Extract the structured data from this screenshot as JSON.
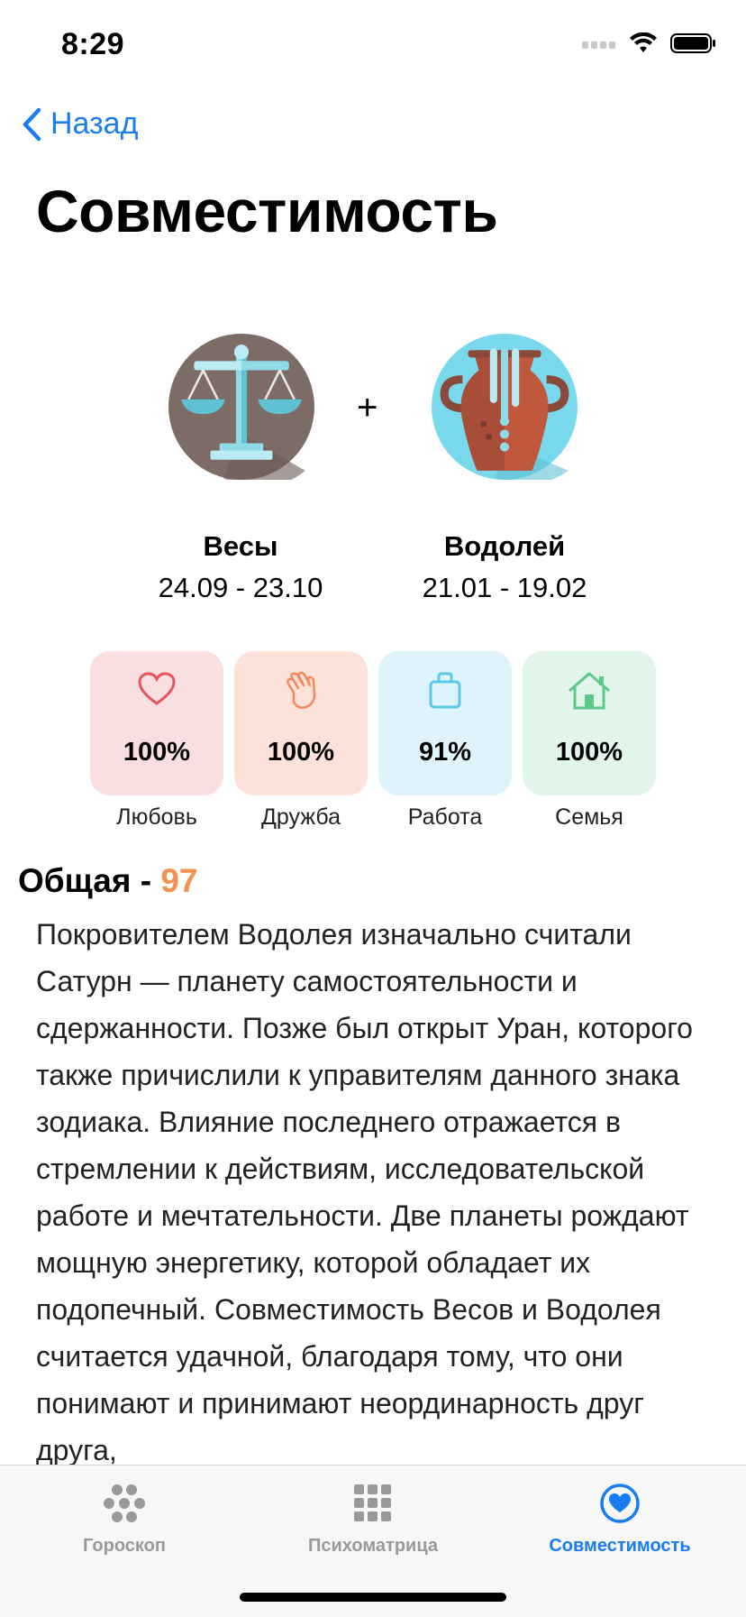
{
  "status": {
    "time": "8:29"
  },
  "nav": {
    "back_label": "Назад"
  },
  "page": {
    "title": "Совместимость"
  },
  "signs": {
    "plus": "+",
    "first": {
      "name": "Весы",
      "dates": "24.09 - 23.10",
      "icon": "libra-scales-icon"
    },
    "second": {
      "name": "Водолей",
      "dates": "21.01 - 19.02",
      "icon": "aquarius-vase-icon"
    }
  },
  "scores": [
    {
      "label": "Любовь",
      "value": "100%",
      "icon": "heart-icon",
      "bg": "#fadfe0",
      "color": "#e8525b"
    },
    {
      "label": "Дружба",
      "value": "100%",
      "icon": "hand-wave-icon",
      "bg": "#fde2d9",
      "color": "#f2895a"
    },
    {
      "label": "Работа",
      "value": "91%",
      "icon": "briefcase-icon",
      "bg": "#dff3fb",
      "color": "#5ac8e8"
    },
    {
      "label": "Семья",
      "value": "100%",
      "icon": "house-icon",
      "bg": "#e2f5ea",
      "color": "#5cc98a"
    }
  ],
  "overall": {
    "label": "Общая - ",
    "value": "97",
    "color": "#f29152"
  },
  "description": "Покровителем Водолея изначально считали Сатурн — планету самостоятельности и сдержанности. Позже был открыт Уран, которого также причислили к управителям данного знака зодиака. Влияние последнего отражается в стремлении к действиям, исследовательской работе и мечтательности. Две планеты рождают мощную энергетику, которой обладает их подопечный. Совместимость Весов и Водолея считается удачной, благодаря тому, что они понимают и принимают неординарность друг друга,",
  "tabs": [
    {
      "label": "Гороскоп",
      "icon": "horoscope-dots-icon",
      "active": false
    },
    {
      "label": "Психоматрица",
      "icon": "grid-icon",
      "active": false
    },
    {
      "label": "Совместимость",
      "icon": "heart-circle-icon",
      "active": true
    }
  ],
  "colors": {
    "accent": "#1a7cf2",
    "overall_number": "#f29152"
  }
}
